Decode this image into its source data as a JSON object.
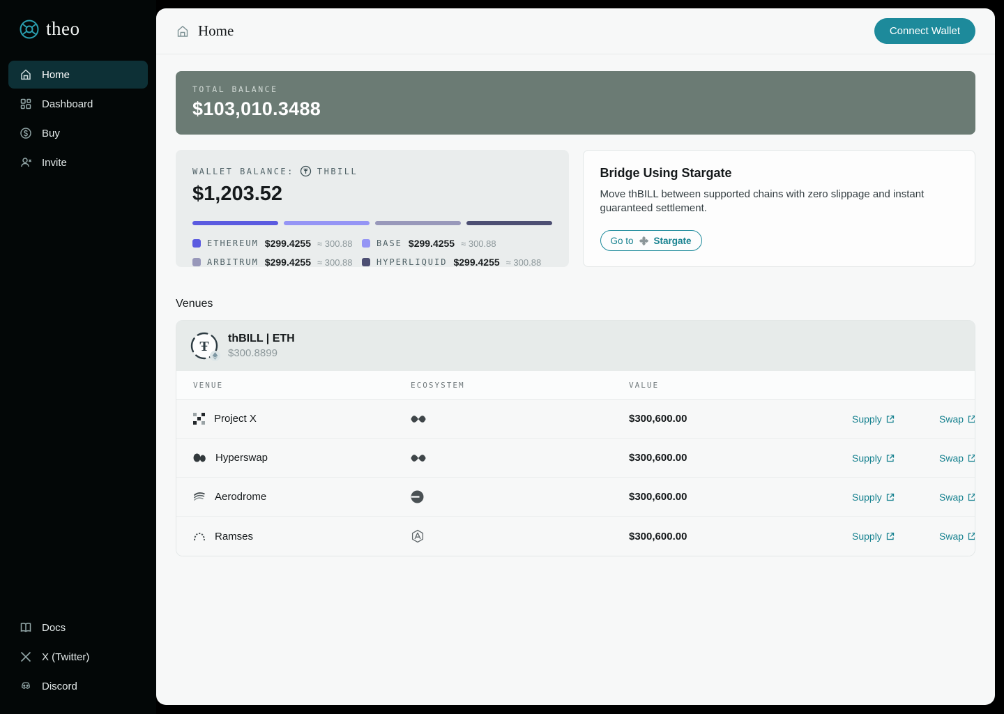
{
  "brand": {
    "name": "theo"
  },
  "sidebar": {
    "items": [
      {
        "label": "Home",
        "active": true
      },
      {
        "label": "Dashboard",
        "active": false
      },
      {
        "label": "Buy",
        "active": false
      },
      {
        "label": "Invite",
        "active": false
      }
    ],
    "footer_items": [
      {
        "label": "Docs"
      },
      {
        "label": "X (Twitter)"
      },
      {
        "label": "Discord"
      }
    ]
  },
  "header": {
    "title": "Home",
    "connect_wallet_label": "Connect Wallet"
  },
  "colors": {
    "accent_teal": "#1d8a9b",
    "link_teal": "#16818f",
    "total_card_bg": "#6b7b74",
    "sidebar_active_bg": "#0d3036"
  },
  "total_balance": {
    "label": "TOTAL BALANCE",
    "value": "$103,010.3488"
  },
  "wallet_balance": {
    "label": "WALLET BALANCE:",
    "token": "THBILL",
    "value": "$1,203.52",
    "chains": [
      {
        "name": "ETHEREUM",
        "value": "$299.4255",
        "approx": "≈ 300.88",
        "color": "#5b5be0"
      },
      {
        "name": "BASE",
        "value": "$299.4255",
        "approx": "≈ 300.88",
        "color": "#9595f5"
      },
      {
        "name": "ARBITRUM",
        "value": "$299.4255",
        "approx": "≈ 300.88",
        "color": "#9898ba"
      },
      {
        "name": "HYPERLIQUID",
        "value": "$299.4255",
        "approx": "≈ 300.88",
        "color": "#4d4f73"
      }
    ]
  },
  "bridge": {
    "title": "Bridge Using Stargate",
    "description": "Move thBILL between supported chains with zero slippage and instant guaranteed settlement.",
    "button_prefix": "Go to",
    "button_brand": "Stargate"
  },
  "venues": {
    "heading": "Venues",
    "token_pair": "thBILL | ETH",
    "token_price": "$300.8899",
    "token_symbol": "Ŧ",
    "columns": [
      "VENUE",
      "ECOSYSTEM",
      "VALUE"
    ],
    "rows": [
      {
        "venue": "Project X",
        "ecosystem": "hyperliquid",
        "value": "$300,600.00",
        "supply_label": "Supply",
        "swap_label": "Swap"
      },
      {
        "venue": "Hyperswap",
        "ecosystem": "hyperliquid",
        "value": "$300,600.00",
        "supply_label": "Supply",
        "swap_label": "Swap"
      },
      {
        "venue": "Aerodrome",
        "ecosystem": "base",
        "value": "$300,600.00",
        "supply_label": "Supply",
        "swap_label": "Swap"
      },
      {
        "venue": "Ramses",
        "ecosystem": "ramses",
        "value": "$300,600.00",
        "supply_label": "Supply",
        "swap_label": "Swap"
      }
    ]
  }
}
